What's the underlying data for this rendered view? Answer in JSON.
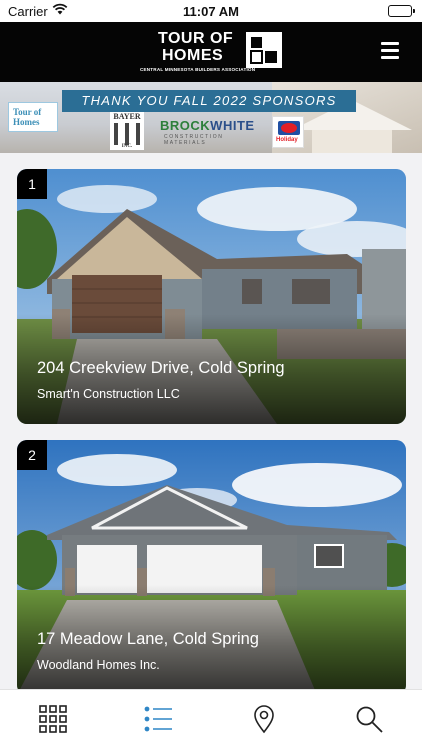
{
  "status_bar": {
    "carrier": "Carrier",
    "time": "11:07 AM"
  },
  "header": {
    "logo_line1": "TOUR OF",
    "logo_line2": "HOMES",
    "logo_tagline": "CENTRAL MINNESOTA BUILDERS ASSOCIATION",
    "menu_icon": "hamburger-menu-icon"
  },
  "banner": {
    "headline": "THANK YOU FALL 2022 SPONSORS",
    "sponsors": [
      {
        "name": "Tour of Homes"
      },
      {
        "name": "BAYER",
        "suffix": "INC."
      },
      {
        "name_part1": "BROCK",
        "name_part2": "WHITE",
        "subtitle": "CONSTRUCTION MATERIALS"
      },
      {
        "name": "Holiday"
      }
    ]
  },
  "listings": [
    {
      "number": "1",
      "address": "204 Creekview Drive, Cold Spring",
      "builder": "Smart'n Construction LLC"
    },
    {
      "number": "2",
      "address": "17 Meadow Lane, Cold Spring",
      "builder": "Woodland Homes Inc."
    }
  ],
  "tab_bar": [
    {
      "icon": "grid-icon",
      "active": false
    },
    {
      "icon": "list-icon",
      "active": true
    },
    {
      "icon": "map-pin-icon",
      "active": false
    },
    {
      "icon": "search-icon",
      "active": false
    }
  ],
  "colors": {
    "header_bg": "#050505",
    "banner_accent": "#2b6e95",
    "active_tab": "#2f86c6",
    "inactive_tab": "#222222"
  }
}
